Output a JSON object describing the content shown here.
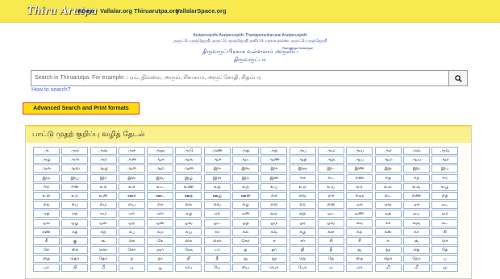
{
  "brand": "Thiru Arutpa",
  "nav": [
    "Home",
    "Vallalar.org",
    "Thiruarutpa.org",
    "VallalarSpace.org"
  ],
  "header_line1": "Arutperunjothi Arutperunjothi Thanipperunkarunai Arutperunjothi",
  "header_line2": "அருட்பெருஞ்ஜோதி அருட்பெருஞ்ஜோதி தனிப்பெருங்கருணை அருட்பெருஞ்ஜோதி",
  "header_caption": "Ramalinga Swamigal",
  "title_line1": "திருவருட்பிரகாச வள்ளலார் அருளிய",
  "title_line2": "திருவருட்பா",
  "search": {
    "placeholder": "Search in Thiruarutpa. For example: பரம், தில்லை, அருள், சிவகாம, அருட்சோதி, சிதம்பர",
    "value": ""
  },
  "howto": "How to search?",
  "advanced": "Advanced Search and Print formats",
  "panel_title": "பாட்டு முதற் குறிப்பு வழித் தேடல்",
  "grid": [
    [
      "அ",
      "அக",
      "அங",
      "அச",
      "அஞ",
      "அடு",
      "அண",
      "அத",
      "அந",
      "அப",
      "அம",
      "அய",
      "அர",
      "அல",
      "அவ"
    ],
    [
      "அழ",
      "அள",
      "அற",
      "அன",
      "ஆக",
      "ஆங",
      "ஆச",
      "ஆட",
      "ஆண",
      "ஆத",
      "ஆந",
      "ஆப",
      "ஆம",
      "ஆய",
      "ஆர"
    ],
    [
      "ஆல",
      "ஆவ",
      "ஆழ",
      "ஆள",
      "ஆற",
      "ஆன",
      "இக",
      "இங",
      "இச",
      "இஞ",
      "இட",
      "இண",
      "இத",
      "இந",
      "இப"
    ],
    [
      "இம",
      "இய",
      "இர",
      "இல",
      "இவ",
      "இழ",
      "இள",
      "இற",
      "இன",
      "ஈச",
      "ஈட",
      "ஈண",
      "ஈத",
      "ஈந",
      "ஈர"
    ],
    [
      "ஈற",
      "ஈன",
      "உக",
      "உச",
      "உட",
      "உண",
      "உத",
      "உந",
      "உப",
      "உம",
      "உய",
      "உர",
      "உல",
      "உவ",
      "உழ"
    ],
    [
      "உள",
      "உற",
      "உன",
      "ஊக",
      "ஊட",
      "ஊத",
      "ஊழ",
      "ஊன",
      "எக",
      "எங",
      "எச",
      "எஞ",
      "எட",
      "எண",
      "எத"
    ],
    [
      "எந",
      "எப",
      "எம",
      "எய",
      "எர",
      "எல",
      "எவ",
      "எழ",
      "எள",
      "எற",
      "என",
      "ஏக",
      "ஏங",
      "ஏச",
      "ஏட"
    ],
    [
      "ஏத",
      "ஏந",
      "ஏம",
      "ஏர",
      "ஏல",
      "ஏழ",
      "ஏற",
      "ஏன",
      "ஐய",
      "ஐந",
      "ஒட",
      "ஒண",
      "ஒத",
      "ஒப",
      "ஒர"
    ],
    [
      "ஒல",
      "ஒழ",
      "ஒள",
      "ஒற",
      "ஒன",
      "ஓங",
      "ஓட",
      "ஓத",
      "ஓம",
      "ஓர",
      "ஓவ",
      "கங",
      "கச",
      "கஞ",
      "கட"
    ],
    [
      "கண",
      "கத",
      "கந",
      "கப",
      "கம",
      "கய",
      "கர",
      "கல",
      "கவ",
      "கழ",
      "கள",
      "கற",
      "கன",
      "கா",
      "கி"
    ],
    [
      "கீ",
      "கு",
      "கூ",
      "கெ",
      "கே",
      "கை",
      "கொ",
      "கோ",
      "ச",
      "சா",
      "சி",
      "சீ",
      "சு",
      "சூ",
      "செ"
    ],
    [
      "சே",
      "சை",
      "சொ",
      "சோ",
      "ஞா",
      "ஞே",
      "டா",
      "த",
      "தா",
      "தி",
      "தீ",
      "து",
      "தூ",
      "தெ",
      "தே"
    ],
    [
      "தை",
      "தொ",
      "தோ",
      "ந",
      "நா",
      "நி",
      "நீ",
      "நு",
      "நூ",
      "நெ",
      "நே",
      "நை",
      "நொ",
      "நோ",
      "ப"
    ],
    [
      "பா",
      "பி",
      "பீ",
      "பு",
      "பூ",
      "பெ",
      "பே",
      "பை",
      "பொ",
      "போ",
      "ம",
      "மா",
      "மி",
      "மீ",
      "மு"
    ]
  ]
}
